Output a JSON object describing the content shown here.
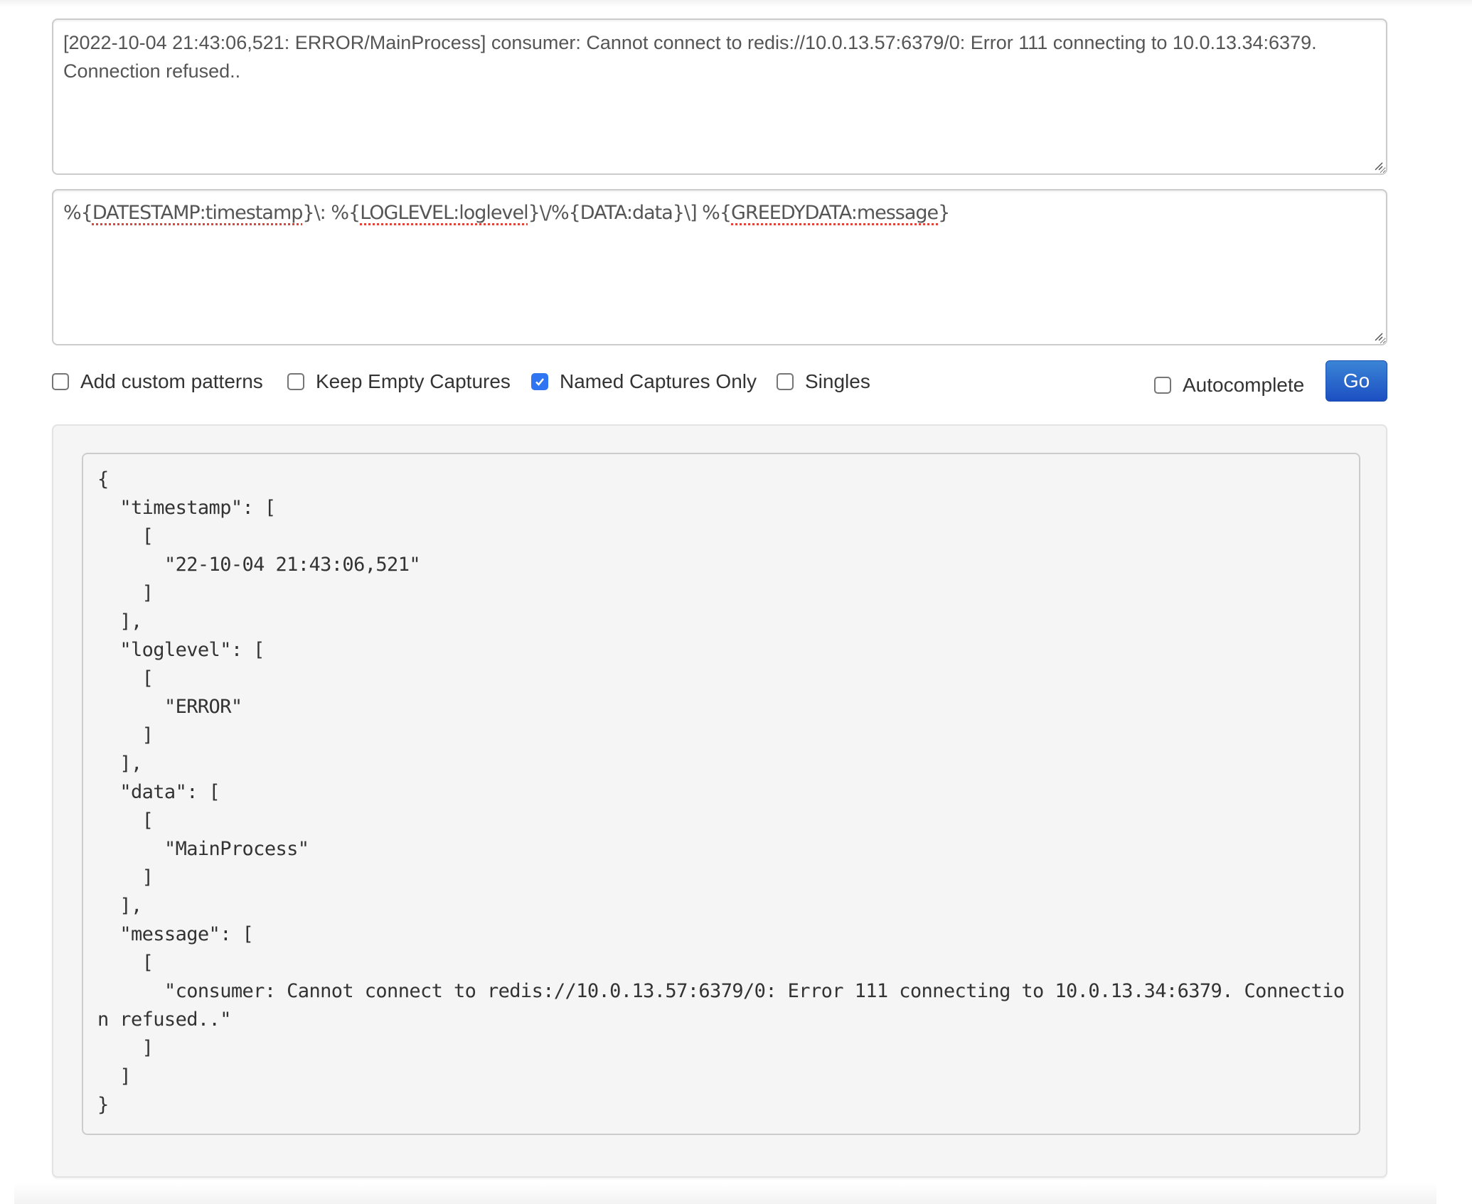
{
  "input": {
    "log_line": "[2022-10-04 21:43:06,521: ERROR/MainProcess] consumer: Cannot connect to redis://10.0.13.57:6379/0: Error 111 connecting to 10.0.13.34:6379. Connection refused.."
  },
  "pattern": {
    "segments": [
      {
        "text": "%{",
        "spell": false
      },
      {
        "text": "DATESTAMP:timestamp",
        "spell": true
      },
      {
        "text": "}\\: %{",
        "spell": false
      },
      {
        "text": "LOGLEVEL:loglevel",
        "spell": true
      },
      {
        "text": "}\\/%{DATA:data}\\] %{",
        "spell": false
      },
      {
        "text": "GREEDYDATA:message",
        "spell": true
      },
      {
        "text": "}",
        "spell": false
      }
    ]
  },
  "options": {
    "add_custom_patterns": {
      "label": "Add custom patterns",
      "checked": false
    },
    "keep_empty_captures": {
      "label": "Keep Empty Captures",
      "checked": false
    },
    "named_captures_only": {
      "label": "Named Captures Only",
      "checked": true
    },
    "singles": {
      "label": "Singles",
      "checked": false
    },
    "autocomplete": {
      "label": "Autocomplete",
      "checked": false
    }
  },
  "go_button": {
    "label": "Go"
  },
  "colors": {
    "accent": "#2f74f0",
    "go_button": "#1c4fc2",
    "spellcheck": "#e0443a"
  },
  "result": {
    "captures": [
      {
        "key": "timestamp",
        "values": [
          "22-10-04 21:43:06,521"
        ]
      },
      {
        "key": "loglevel",
        "values": [
          "ERROR"
        ]
      },
      {
        "key": "data",
        "values": [
          "MainProcess"
        ]
      },
      {
        "key": "message",
        "values": [
          "consumer: Cannot connect to redis://10.0.13.57:6379/0: Error 111 connecting to 10.0.13.34:6379. Connection refused.."
        ]
      }
    ]
  }
}
